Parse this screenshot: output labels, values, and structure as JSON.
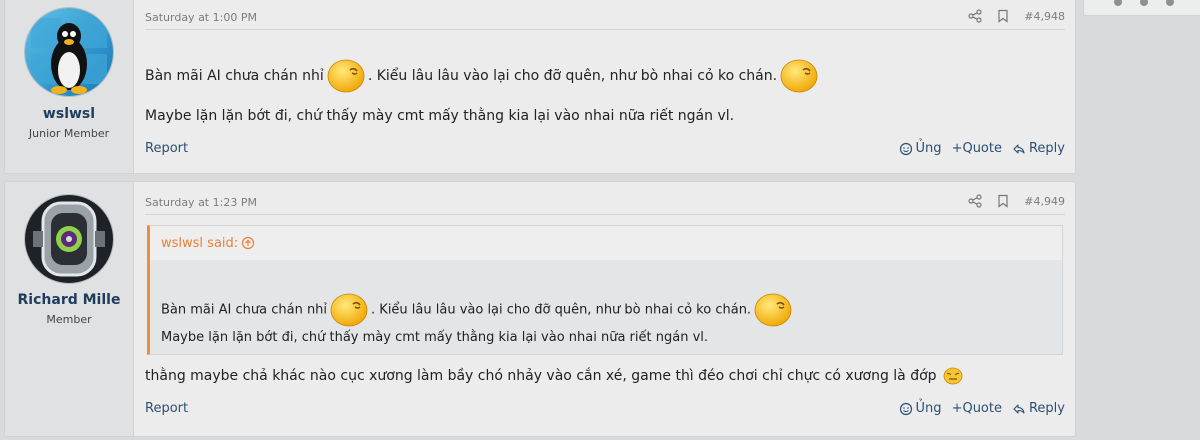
{
  "posts": [
    {
      "username": "wslwsl",
      "user_title": "Junior Member",
      "date": "Saturday at 1:00 PM",
      "post_number": "#4,948",
      "line1_a": "Bàn mãi AI chưa chán nhỉ",
      "line1_b": ". Kiểu lâu lâu vào lại cho đỡ quên, như bò nhai cỏ ko chán.",
      "line2": "Maybe lặn lặn bớt đi, chứ thấy mày cmt mấy thằng kia lại vào nhai nữa riết ngán vl.",
      "report_label": "Report",
      "ung_label": "Ủng",
      "quote_label": "+Quote",
      "reply_label": "Reply"
    },
    {
      "username": "Richard Mille",
      "user_title": "Member",
      "date": "Saturday at 1:23 PM",
      "post_number": "#4,949",
      "quote_author": "wslwsl said:",
      "quote_line1_a": "Bàn mãi AI chưa chán nhỉ",
      "quote_line1_b": ". Kiểu lâu lâu vào lại cho đỡ quên, như bò nhai cỏ ko chán.",
      "quote_line2": "Maybe lặn lặn bớt đi, chứ thấy mày cmt mấy thằng kia lại vào nhai nữa riết ngán vl.",
      "reply_text": "thằng maybe chả khác nào cục xương làm bầy chó nhảy vào cắn xé, game thì đéo chơi chỉ chực có xương là đớp",
      "report_label": "Report",
      "ung_label": "Ủng",
      "quote_label": "+Quote",
      "reply_label": "Reply"
    }
  ],
  "icons": {
    "share": "share-icon",
    "bookmark": "bookmark-icon",
    "smile": "smile-emoji-icon",
    "react": "react-icon",
    "reply": "reply-icon",
    "quote_arrow": "arrow-up-icon"
  },
  "colors": {
    "accent": "#f08c3a",
    "username": "#1f3d5c",
    "link": "#2c4f74"
  }
}
